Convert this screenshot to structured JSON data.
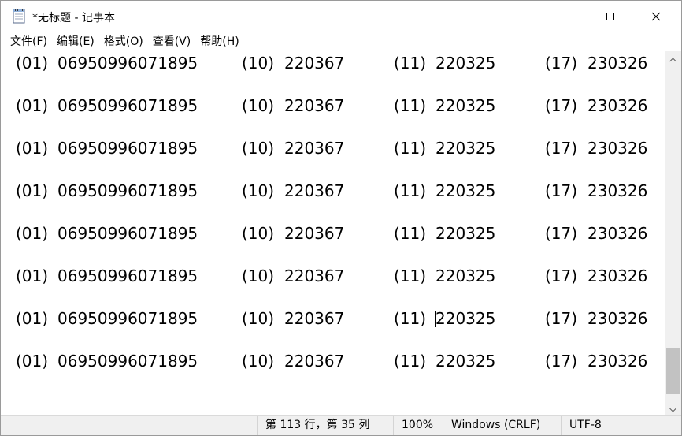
{
  "window": {
    "title": "*无标题 - 记事本",
    "icon": "notepad-icon",
    "controls": [
      "minimize-icon",
      "maximize-icon",
      "close-icon"
    ]
  },
  "menu": [
    {
      "name": "menu-file",
      "label": "文件(F)"
    },
    {
      "name": "menu-edit",
      "label": "编辑(E)"
    },
    {
      "name": "menu-format",
      "label": "格式(O)"
    },
    {
      "name": "menu-view",
      "label": "查看(V)"
    },
    {
      "name": "menu-help",
      "label": "帮助(H)"
    }
  ],
  "editor": {
    "lines": [
      {
        "ai1": "(01)",
        "v1": "06950996071895",
        "ai2": "(10)",
        "v2": "220367",
        "ai3": "(11)",
        "v3": "220325",
        "ai4": "(17)",
        "v4": "230326"
      },
      {
        "ai1": "(01)",
        "v1": "06950996071895",
        "ai2": "(10)",
        "v2": "220367",
        "ai3": "(11)",
        "v3": "220325",
        "ai4": "(17)",
        "v4": "230326"
      },
      {
        "ai1": "(01)",
        "v1": "06950996071895",
        "ai2": "(10)",
        "v2": "220367",
        "ai3": "(11)",
        "v3": "220325",
        "ai4": "(17)",
        "v4": "230326"
      },
      {
        "ai1": "(01)",
        "v1": "06950996071895",
        "ai2": "(10)",
        "v2": "220367",
        "ai3": "(11)",
        "v3": "220325",
        "ai4": "(17)",
        "v4": "230326"
      },
      {
        "ai1": "(01)",
        "v1": "06950996071895",
        "ai2": "(10)",
        "v2": "220367",
        "ai3": "(11)",
        "v3": "220325",
        "ai4": "(17)",
        "v4": "230326"
      },
      {
        "ai1": "(01)",
        "v1": "06950996071895",
        "ai2": "(10)",
        "v2": "220367",
        "ai3": "(11)",
        "v3": "220325",
        "ai4": "(17)",
        "v4": "230326"
      },
      {
        "ai1": "(01)",
        "v1": "06950996071895",
        "ai2": "(10)",
        "v2": "220367",
        "ai3": "(11)",
        "v3": "220325",
        "ai4": "(17)",
        "v4": "230326"
      },
      {
        "ai1": "(01)",
        "v1": "06950996071895",
        "ai2": "(10)",
        "v2": "220367",
        "ai3": "(11)",
        "v3": "220325",
        "ai4": "(17)",
        "v4": "230326"
      }
    ]
  },
  "status": {
    "position": "第 113 行，第 35 列",
    "zoom": "100%",
    "line_ending": "Windows (CRLF)",
    "encoding": "UTF-8"
  }
}
